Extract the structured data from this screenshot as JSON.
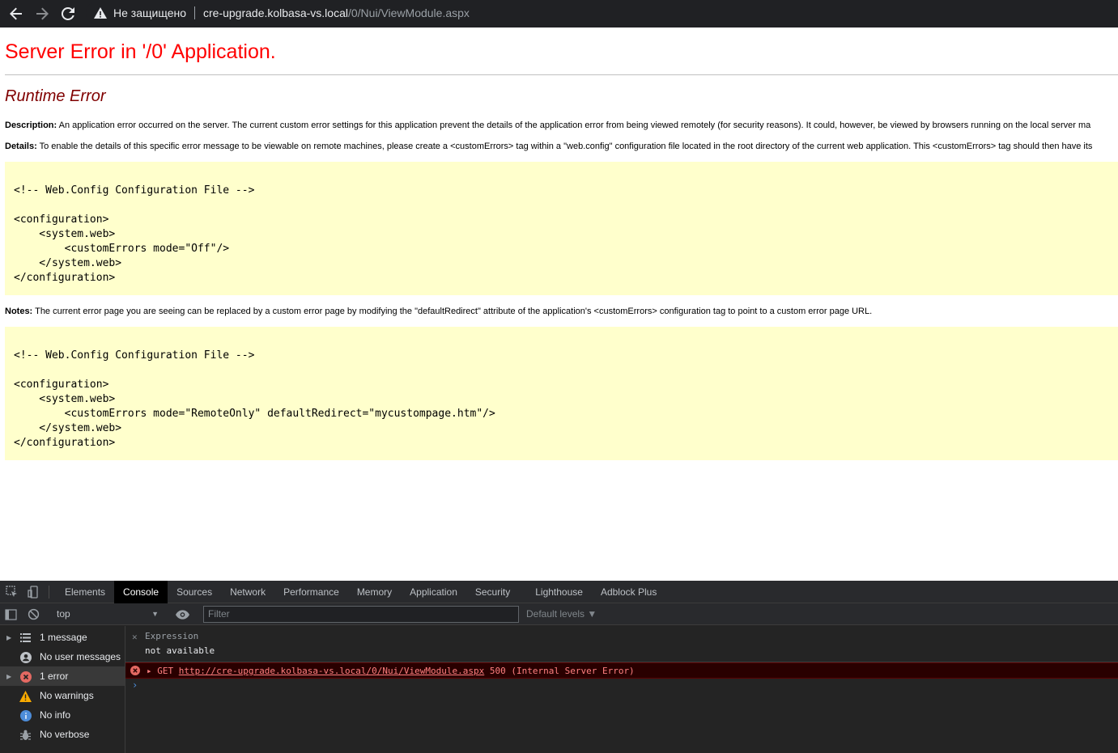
{
  "browser": {
    "security_label": "Не защищено",
    "url_host": "cre-upgrade.kolbasa-vs.local",
    "url_path": "/0/Nui/ViewModule.aspx"
  },
  "page": {
    "title": "Server Error in '/0' Application.",
    "subtitle": "Runtime Error",
    "description_label": "Description:",
    "description_text": "An application error occurred on the server. The current custom error settings for this application prevent the details of the application error from being viewed remotely (for security reasons). It could, however, be viewed by browsers running on the local server ma",
    "details_label": "Details:",
    "details_text": "To enable the details of this specific error message to be viewable on remote machines, please create a <customErrors> tag within a \"web.config\" configuration file located in the root directory of the current web application. This <customErrors> tag should then have its",
    "code1": "\n<!-- Web.Config Configuration File -->\n\n<configuration>\n    <system.web>\n        <customErrors mode=\"Off\"/>\n    </system.web>\n</configuration>",
    "notes_label": "Notes:",
    "notes_text": "The current error page you are seeing can be replaced by a custom error page by modifying the \"defaultRedirect\" attribute of the application's <customErrors> configuration tag to point to a custom error page URL.",
    "code2": "\n<!-- Web.Config Configuration File -->\n\n<configuration>\n    <system.web>\n        <customErrors mode=\"RemoteOnly\" defaultRedirect=\"mycustompage.htm\"/>\n    </system.web>\n</configuration>"
  },
  "devtools": {
    "tabs": [
      "Elements",
      "Console",
      "Sources",
      "Network",
      "Performance",
      "Memory",
      "Application",
      "Security",
      "Lighthouse",
      "Adblock Plus"
    ],
    "active_tab": "Console",
    "context": "top",
    "filter_placeholder": "Filter",
    "levels": "Default levels ▼",
    "sidebar": [
      {
        "label": "1 message",
        "icon": "list-icon"
      },
      {
        "label": "No user messages",
        "icon": "user-icon"
      },
      {
        "label": "1 error",
        "icon": "error-icon"
      },
      {
        "label": "No warnings",
        "icon": "warning-icon"
      },
      {
        "label": "No info",
        "icon": "info-icon"
      },
      {
        "label": "No verbose",
        "icon": "bug-icon"
      }
    ],
    "expression_label": "Expression",
    "expression_value": "not available",
    "error_method": "GET",
    "error_url": "http://cre-upgrade.kolbasa-vs.local/0/Nui/ViewModule.aspx",
    "error_status": "500 (Internal Server Error)",
    "colors": {
      "error_bg": "#290000",
      "error_text": "#ff8080",
      "warning": "#f9ab00",
      "info": "#4d8dd9"
    }
  }
}
